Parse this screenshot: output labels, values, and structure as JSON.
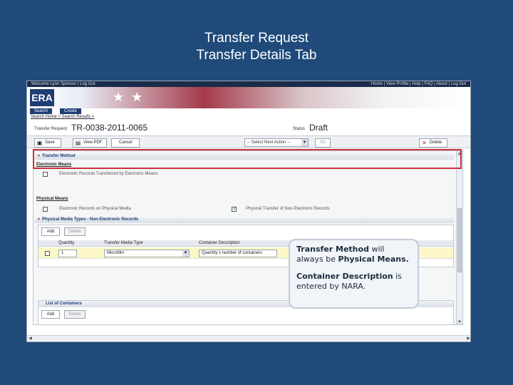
{
  "slide": {
    "title_line1": "Transfer Request",
    "title_line2": "Transfer Details Tab"
  },
  "app": {
    "topbar_left": "Welcome Lynn Spencer | Log Out",
    "topbar_right": "Home | View Profile | Help | FAQ | About | Log Out",
    "logo_text": "ERA",
    "nav_tabs": [
      "Search",
      "Create"
    ],
    "breadcrumb": "Search Home > Search Results >",
    "request_label": "Transfer Request",
    "request_number": "TR-0038-2011-0065",
    "status_label": "Status",
    "status_value": "Draft"
  },
  "toolbar": {
    "save_label": "Save",
    "view_pdf_label": "View PDF",
    "cancel_label": "Cancel",
    "next_action_placeholder": "-- Select Next Action --",
    "go_label": "Go",
    "delete_label": "Delete"
  },
  "transfer_method": {
    "header": "Transfer Method",
    "electronic_means_label": "Electronic Means",
    "electronic_option": "Electronic Records Transferred by Electronic Means",
    "physical_means_label": "Physical Means",
    "physical_option_1": "Electronic Records on Physical Media",
    "physical_option_2": "Physical Transfer of Non-Electronic Records"
  },
  "media_types": {
    "header": "Physical Media Types - Non-Electronic Records",
    "add_label": "Add",
    "delete_label": "Delete",
    "columns": [
      "Quantity",
      "Transfer Media Type",
      "Container Description"
    ],
    "row": {
      "quantity": "1",
      "media_type": "Microfilm",
      "description": "Quantity x number of containers"
    }
  },
  "containers": {
    "header": "List of Containers",
    "add_label": "Add",
    "delete_label": "Delete"
  },
  "callout": {
    "p1_bold": "Transfer Method",
    "p1_rest": " will always be ",
    "p1_bold2": "Physical Means.",
    "p2_bold": "Container Description",
    "p2_rest": " is entered by NARA."
  },
  "colors": {
    "slide_bg": "#1f4a7a",
    "highlight_border": "#c9313b",
    "row_highlight": "#fbf7c8"
  }
}
